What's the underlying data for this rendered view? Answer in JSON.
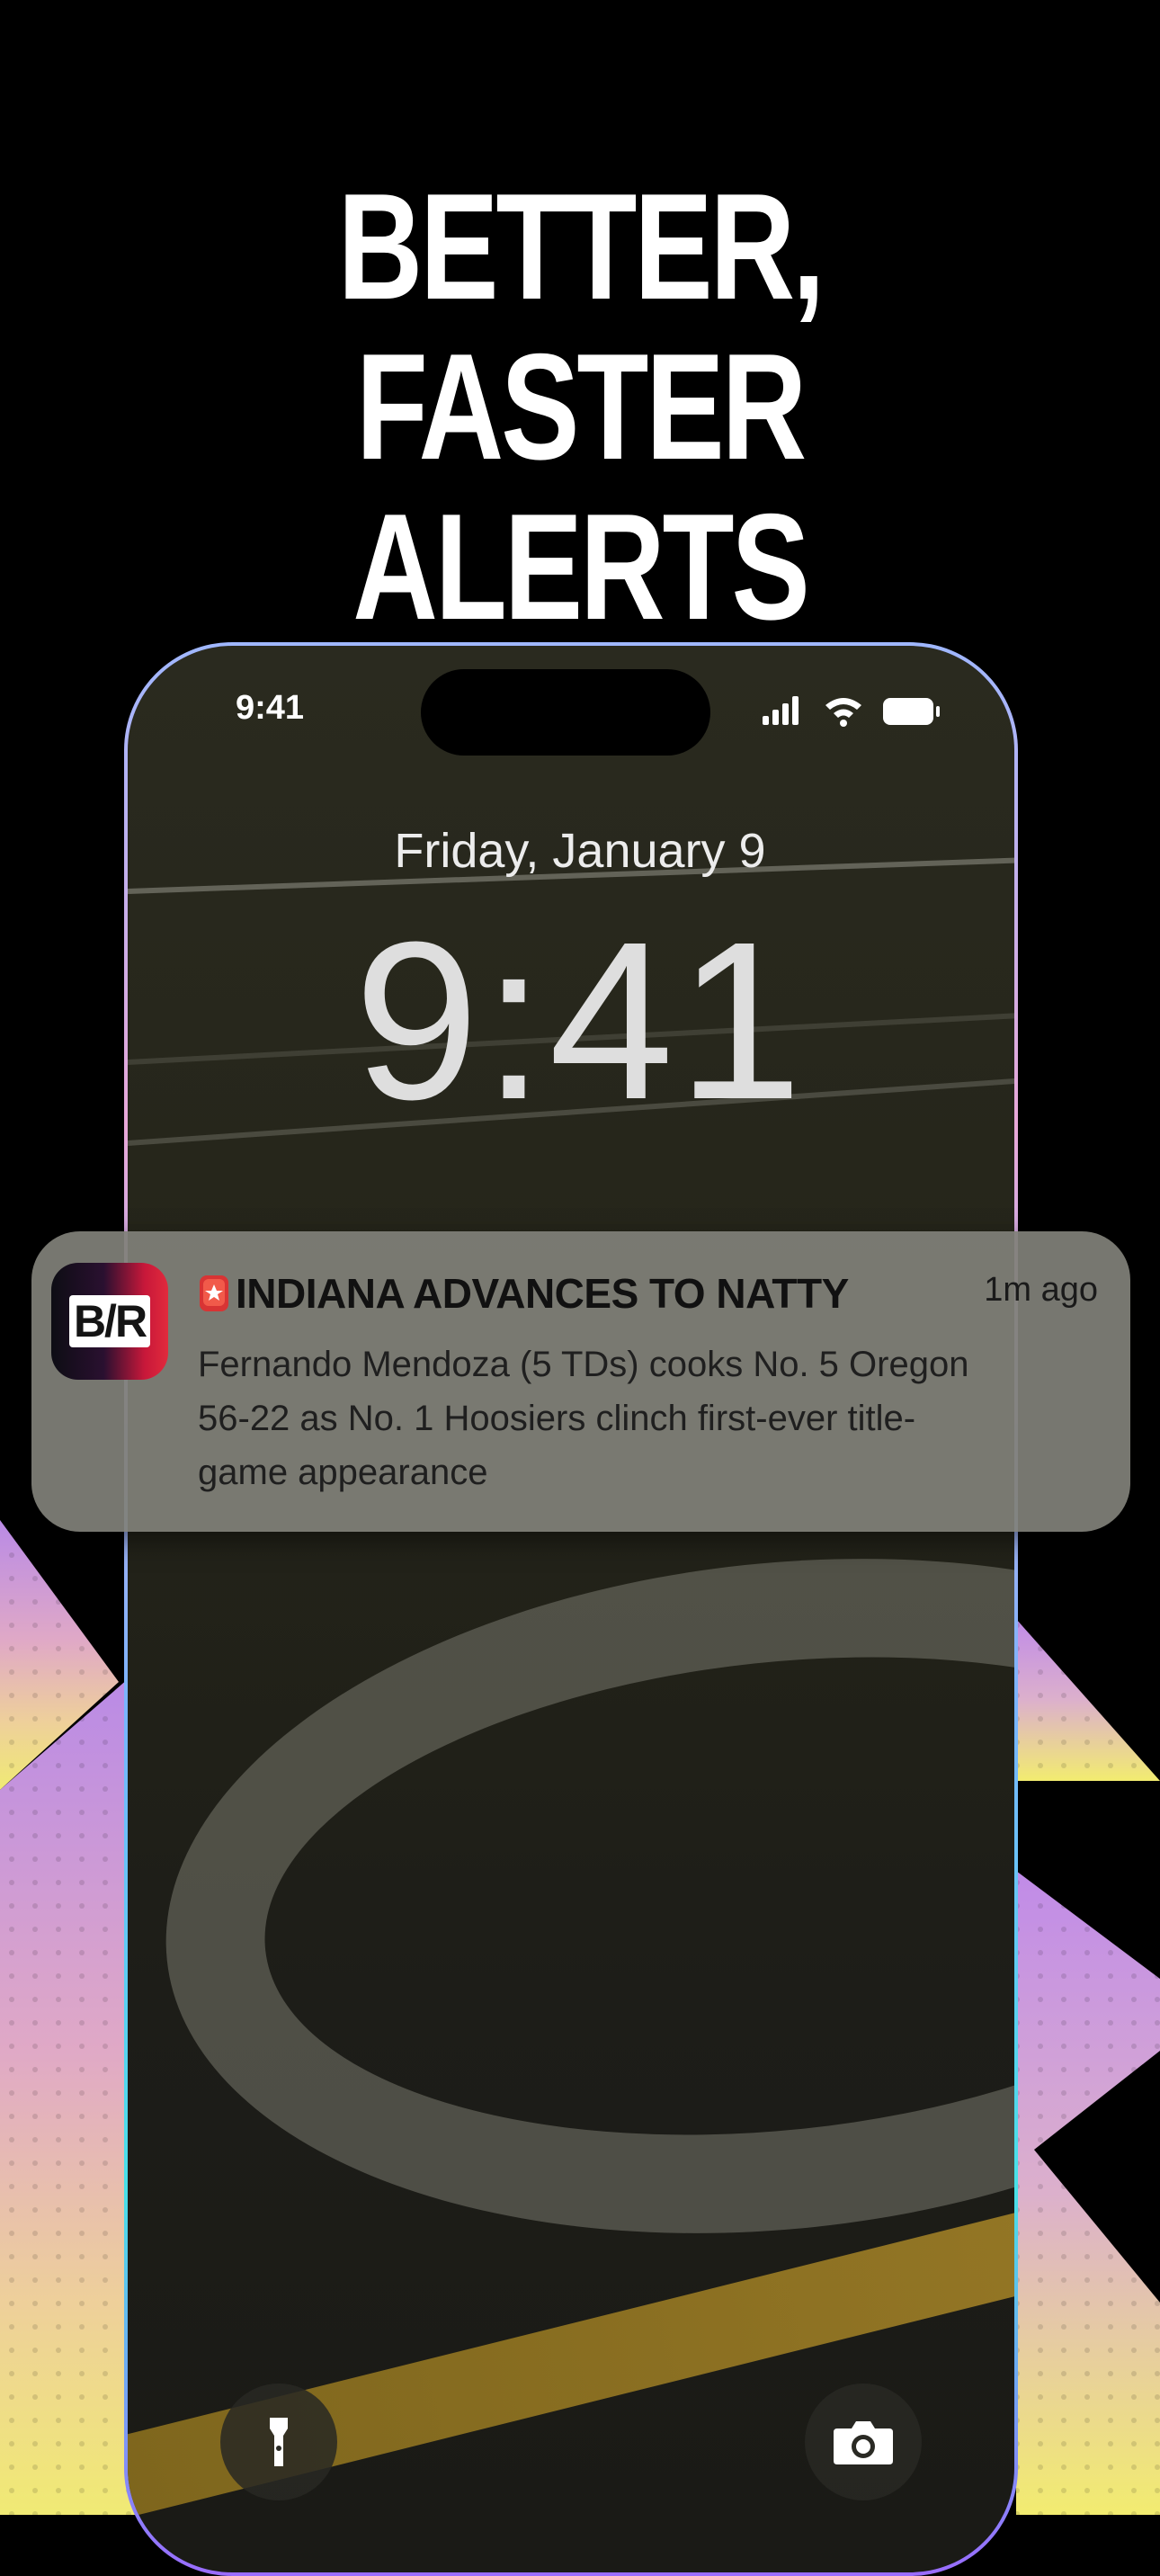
{
  "headline": {
    "line1": "BETTER, FASTER",
    "line2": "ALERTS"
  },
  "status_bar": {
    "time": "9:41",
    "icons": [
      "signal-icon",
      "wifi-icon",
      "battery-icon"
    ]
  },
  "lock_screen": {
    "date": "Friday, January 9",
    "clock": "9:41"
  },
  "notification": {
    "app_icon_label": "B/R",
    "siren_icon": "siren-emoji-icon",
    "title": "INDIANA ADVANCES TO NATTY",
    "time": "1m ago",
    "body": "Fernando Mendoza (5 TDs) cooks No. 5 Oregon 56-22 as No. 1 Hoosiers clinch first-ever title-game appearance"
  },
  "bottom_controls": {
    "left": "flashlight-icon",
    "right": "camera-icon"
  },
  "colors": {
    "background": "#000000",
    "notification_bg": "#808078",
    "brand_red": "#e12a3c",
    "deco_purple": "#c08be8",
    "deco_yellow": "#eae37a"
  }
}
